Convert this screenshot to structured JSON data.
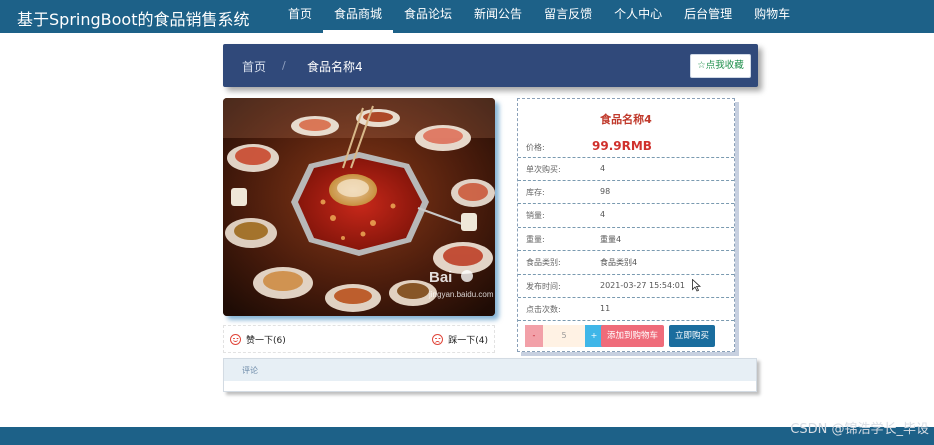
{
  "app": {
    "title": "基于SpringBoot的食品销售系统"
  },
  "nav": {
    "items": [
      {
        "label": "首页",
        "active": false
      },
      {
        "label": "食品商城",
        "active": true
      },
      {
        "label": "食品论坛",
        "active": false
      },
      {
        "label": "新闻公告",
        "active": false
      },
      {
        "label": "留言反馈",
        "active": false
      },
      {
        "label": "个人中心",
        "active": false
      },
      {
        "label": "后台管理",
        "active": false
      },
      {
        "label": "购物车",
        "active": false
      }
    ]
  },
  "breadcrumb": {
    "home": "首页",
    "separator": "/",
    "current": "食品名称4",
    "favorite_label": "☆点我收藏"
  },
  "likes": {
    "like_label": "赞一下(6)",
    "dislike_label": "踩一下(4)"
  },
  "product": {
    "name": "食品名称4",
    "price_label": "价格:",
    "price_value": "99.9RMB",
    "rows": [
      {
        "label": "单次购买:",
        "value": "4"
      },
      {
        "label": "库存:",
        "value": "98"
      },
      {
        "label": "销量:",
        "value": "4"
      },
      {
        "label": "重量:",
        "value": "重量4"
      },
      {
        "label": "食品类别:",
        "value": "食品类别4"
      },
      {
        "label": "发布时间:",
        "value": "2021-03-27 15:54:01"
      },
      {
        "label": "点击次数:",
        "value": "11"
      }
    ],
    "qty_minus": "-",
    "qty_value": "5",
    "qty_plus": "+",
    "add_to_cart_label": "添加到购物车",
    "buy_now_label": "立即购买"
  },
  "comments": {
    "label": "评论"
  },
  "image_watermark": {
    "brand": "Bai",
    "site": "jingyan.baidu.com"
  },
  "watermark": "CSDN @锦浩学长_毕设",
  "colors": {
    "nav_bg": "#1d6188",
    "crumb_bg": "#30497a",
    "price": "#d0312d",
    "cart_btn": "#ef6b7a",
    "buy_btn": "#1a6d9e"
  }
}
